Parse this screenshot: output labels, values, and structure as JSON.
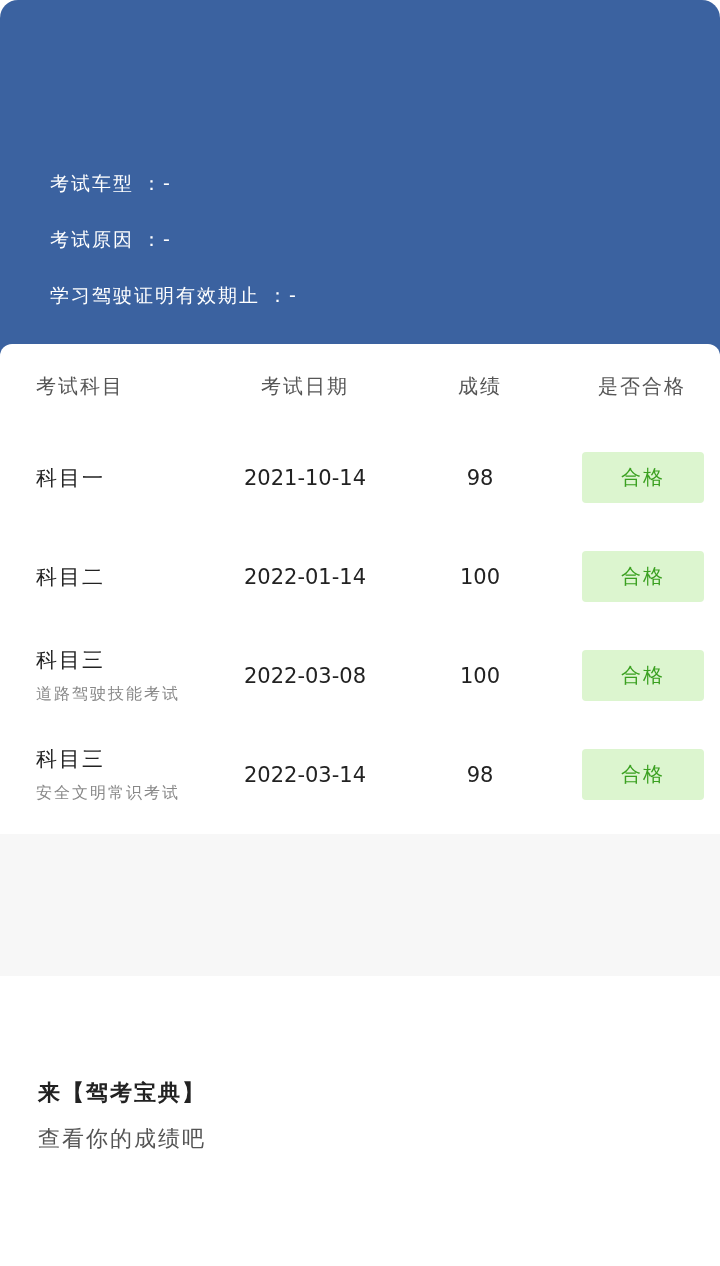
{
  "info": [
    "考试车型 ：-",
    "考试原因 ：-",
    "学习驾驶证明有效期止 ：-"
  ],
  "table": {
    "columns": [
      "考试科目",
      "考试日期",
      "成绩",
      "是否合格"
    ],
    "rows": [
      {
        "subject": "科目一",
        "date": "2021-10-14",
        "score": "98",
        "result": "合格",
        "passed": true
      },
      {
        "subject": "科目二",
        "date": "2022-01-14",
        "score": "100",
        "result": "合格",
        "passed": true
      },
      {
        "subject": "科目三",
        "note": "道路驾驶技能考试",
        "date": "2022-03-08",
        "score": "100",
        "result": "合格",
        "passed": true
      },
      {
        "subject": "科目三",
        "note": "安全文明常识考试",
        "date": "2022-03-14",
        "score": "98",
        "result": "合格",
        "passed": true
      }
    ]
  },
  "footer": {
    "title": "来【驾考宝典】",
    "subtitle": "查看你的成绩吧"
  }
}
